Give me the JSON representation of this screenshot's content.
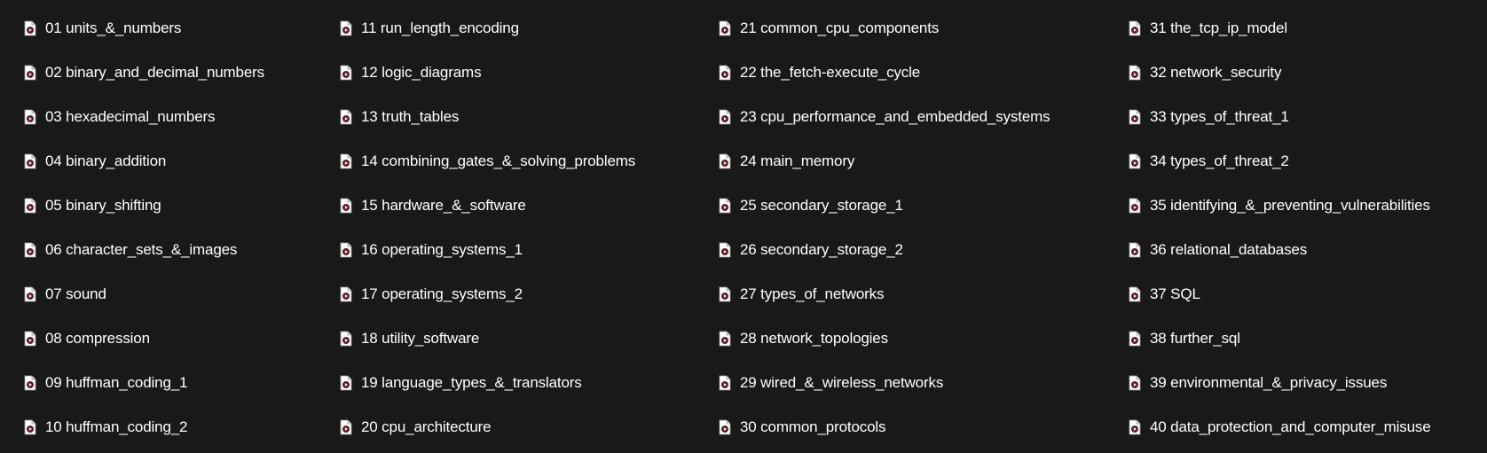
{
  "file_icon": "video-file-icon",
  "colors": {
    "background": "#191919",
    "text": "#ffffff",
    "icon_page": "#ffffff",
    "icon_play": "#5a1f2a"
  },
  "columns": [
    [
      {
        "label": "01 units_&_numbers"
      },
      {
        "label": "02 binary_and_decimal_numbers"
      },
      {
        "label": "03 hexadecimal_numbers"
      },
      {
        "label": "04 binary_addition"
      },
      {
        "label": "05 binary_shifting"
      },
      {
        "label": "06 character_sets_&_images"
      },
      {
        "label": "07 sound"
      },
      {
        "label": "08 compression"
      },
      {
        "label": "09 huffman_coding_1"
      },
      {
        "label": "10 huffman_coding_2"
      }
    ],
    [
      {
        "label": "11 run_length_encoding"
      },
      {
        "label": "12 logic_diagrams"
      },
      {
        "label": "13 truth_tables"
      },
      {
        "label": "14 combining_gates_&_solving_problems"
      },
      {
        "label": "15 hardware_&_software"
      },
      {
        "label": "16 operating_systems_1"
      },
      {
        "label": "17 operating_systems_2"
      },
      {
        "label": "18 utility_software"
      },
      {
        "label": "19 language_types_&_translators"
      },
      {
        "label": "20 cpu_architecture"
      }
    ],
    [
      {
        "label": "21 common_cpu_components"
      },
      {
        "label": "22 the_fetch-execute_cycle"
      },
      {
        "label": "23 cpu_performance_and_embedded_systems"
      },
      {
        "label": "24 main_memory"
      },
      {
        "label": "25 secondary_storage_1"
      },
      {
        "label": "26 secondary_storage_2"
      },
      {
        "label": "27 types_of_networks"
      },
      {
        "label": "28 network_topologies"
      },
      {
        "label": "29 wired_&_wireless_networks"
      },
      {
        "label": "30 common_protocols"
      }
    ],
    [
      {
        "label": "31 the_tcp_ip_model"
      },
      {
        "label": "32 network_security"
      },
      {
        "label": "33 types_of_threat_1"
      },
      {
        "label": "34 types_of_threat_2"
      },
      {
        "label": "35 identifying_&_preventing_vulnerabilities"
      },
      {
        "label": "36 relational_databases"
      },
      {
        "label": "37 SQL"
      },
      {
        "label": "38 further_sql"
      },
      {
        "label": "39 environmental_&_privacy_issues"
      },
      {
        "label": "40 data_protection_and_computer_misuse"
      }
    ]
  ]
}
